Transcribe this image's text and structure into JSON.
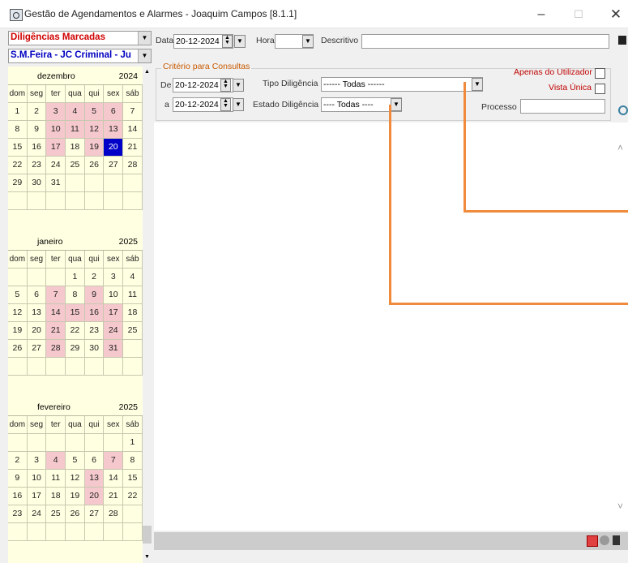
{
  "window": {
    "title": "Gestão de Agendamentos e Alarmes - Joaquim Campos [8.1.1]"
  },
  "left": {
    "combo1": "Diligências Marcadas",
    "combo2": "S.M.Feira - JC Criminal - Ju",
    "weekdays": [
      "dom",
      "seg",
      "ter",
      "qua",
      "qui",
      "sex",
      "sáb"
    ],
    "months": [
      {
        "name": "dezembro",
        "year": "2024",
        "weeks": [
          [
            "1",
            "2",
            "3",
            "4",
            "5",
            "6",
            "7"
          ],
          [
            "8",
            "9",
            "10",
            "11",
            "12",
            "13",
            "14"
          ],
          [
            "15",
            "16",
            "17",
            "18",
            "19",
            "20",
            "21"
          ],
          [
            "22",
            "23",
            "24",
            "25",
            "26",
            "27",
            "28"
          ],
          [
            "29",
            "30",
            "31",
            "",
            "",
            "",
            ""
          ],
          [
            "",
            "",
            "",
            "",
            "",
            "",
            ""
          ]
        ],
        "highlighted": [
          "3",
          "4",
          "5",
          "6",
          "10",
          "11",
          "12",
          "13",
          "17",
          "19"
        ],
        "selected": "20"
      },
      {
        "name": "janeiro",
        "year": "2025",
        "weeks": [
          [
            "",
            "",
            "",
            "1",
            "2",
            "3",
            "4"
          ],
          [
            "5",
            "6",
            "7",
            "8",
            "9",
            "10",
            "11"
          ],
          [
            "12",
            "13",
            "14",
            "15",
            "16",
            "17",
            "18"
          ],
          [
            "19",
            "20",
            "21",
            "22",
            "23",
            "24",
            "25"
          ],
          [
            "26",
            "27",
            "28",
            "29",
            "30",
            "31",
            ""
          ],
          [
            "",
            "",
            "",
            "",
            "",
            "",
            ""
          ]
        ],
        "highlighted": [
          "7",
          "9",
          "14",
          "15",
          "16",
          "17",
          "21",
          "24",
          "28",
          "31"
        ],
        "selected": ""
      },
      {
        "name": "fevereiro",
        "year": "2025",
        "weeks": [
          [
            "",
            "",
            "",
            "",
            "",
            "",
            "1"
          ],
          [
            "2",
            "3",
            "4",
            "5",
            "6",
            "7",
            "8"
          ],
          [
            "9",
            "10",
            "11",
            "12",
            "13",
            "14",
            "15"
          ],
          [
            "16",
            "17",
            "18",
            "19",
            "20",
            "21",
            "22"
          ],
          [
            "23",
            "24",
            "25",
            "26",
            "27",
            "28",
            ""
          ],
          [
            "",
            "",
            "",
            "",
            "",
            "",
            ""
          ]
        ],
        "highlighted": [
          "4",
          "7",
          "13",
          "20"
        ],
        "selected": ""
      }
    ]
  },
  "form": {
    "data_label": "Data",
    "data_value": "20-12-2024",
    "hora_label": "Hora",
    "hora_value": "",
    "descritivo_label": "Descritivo",
    "descritivo_value": "",
    "criterio_label": "Critério para Consultas",
    "de_label": "De",
    "de_value": "20-12-2024",
    "a_label": "a",
    "a_value": "20-12-2024",
    "tipo_label": "Tipo Diligência",
    "tipo_value": "------ Todas ------",
    "estado_label": "Estado Diligência",
    "estado_value": "---- Todas ----",
    "apenas_label": "Apenas do Utilizador",
    "vista_label": "Vista Única",
    "processo_label": "Processo",
    "processo_value": ""
  },
  "colors": {
    "highlight": "#f4c8cc",
    "selected": "#0000c8",
    "calendar_bg": "#ffffe1",
    "callout": "#f08a3c",
    "red_label": "#c00000"
  }
}
